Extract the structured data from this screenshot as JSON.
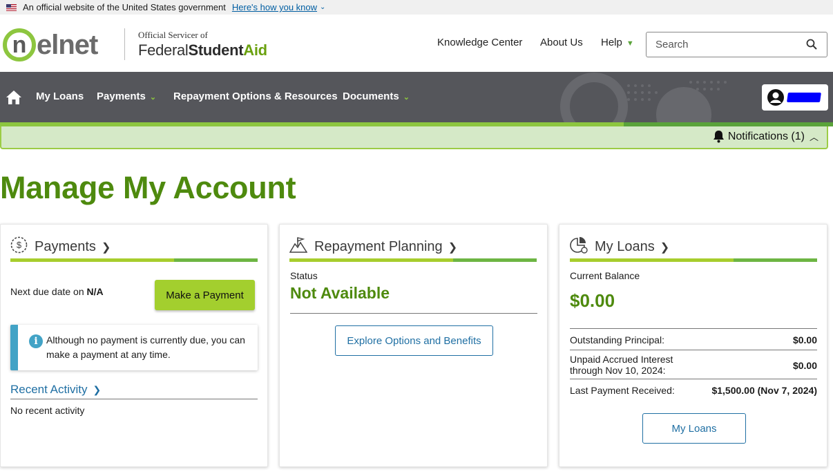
{
  "gov_banner": {
    "text": "An official website of the United States government",
    "link": "Here's how you know"
  },
  "header": {
    "logo": "nelnet",
    "servicer_small": "Official Servicer of",
    "fsa_federal": "Federal",
    "fsa_student": "Student",
    "fsa_aid": "Aid",
    "links": [
      "Knowledge Center",
      "About Us",
      "Help"
    ],
    "search_placeholder": "Search"
  },
  "nav": {
    "items": [
      "My Loans",
      "Payments",
      "Repayment Options & Resources",
      "Documents"
    ]
  },
  "notifications": {
    "label": "Notifications (1)"
  },
  "page_title": "Manage My Account",
  "payments_card": {
    "title": "Payments",
    "next_due_label": "Next due date on",
    "next_due_value": "N/A",
    "button": "Make a Payment",
    "alert": "Although no payment is currently due, you can make a payment at any time.",
    "recent_title": "Recent Activity",
    "recent_empty": "No recent activity"
  },
  "planning_card": {
    "title": "Repayment Planning",
    "status_label": "Status",
    "status_value": "Not Available",
    "button": "Explore Options and Benefits"
  },
  "loans_card": {
    "title": "My Loans",
    "balance_label": "Current Balance",
    "balance_value": "$0.00",
    "rows": [
      {
        "label": "Outstanding Principal:",
        "value": "$0.00"
      },
      {
        "label": "Unpaid Accrued Interest through Nov 10, 2024:",
        "value": "$0.00"
      },
      {
        "label": "Last Payment Received:",
        "value": "$1,500.00 (Nov 7, 2024)"
      }
    ],
    "button": "My Loans"
  },
  "colors": {
    "brand_green": "#4e8a0e",
    "accent_green": "#8dc63f",
    "nav_gray": "#55565b",
    "link_blue": "#1f6fa3"
  }
}
